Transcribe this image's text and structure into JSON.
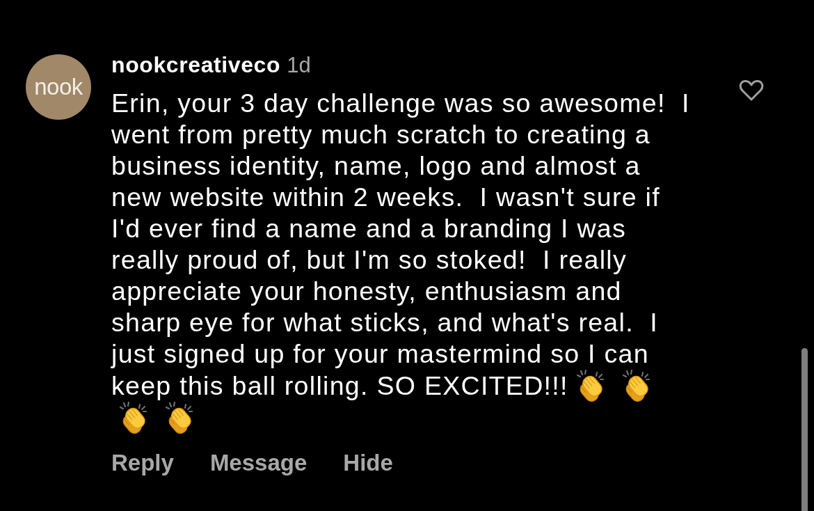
{
  "comment": {
    "avatar_text": "nook",
    "username": "nookcreativeco",
    "time": "1d",
    "liked": false,
    "text": "Erin, your 3 day challenge was so awesome!  I went from pretty much scratch to creating a business identity, name, logo and almost a new website within 2 weeks.  I wasn't sure if I'd ever find a name and a branding I was really proud of, but I'm so stoked!  I really appreciate your honesty, enthusiasm and sharp eye for what sticks, and what's real.  I just signed up for your mastermind so I can keep this ball rolling. SO EXCITED!!!",
    "emoji": [
      {
        "kind": "clapping-hands"
      },
      {
        "kind": "clapping-hands"
      },
      {
        "kind": "clapping-hands"
      },
      {
        "kind": "clapping-hands"
      }
    ]
  },
  "actions": [
    "Reply",
    "Message",
    "Hide"
  ]
}
